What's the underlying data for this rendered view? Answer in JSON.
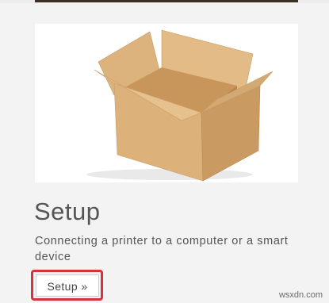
{
  "card": {
    "image_alt": "open cardboard box",
    "title": "Setup",
    "description": "Connecting a printer to a computer or a smart device",
    "button_label": "Setup »"
  },
  "colors": {
    "highlight": "#d9323c",
    "box_main": "#d9b07a",
    "text": "#555555"
  },
  "watermark": "wsxdn.com"
}
